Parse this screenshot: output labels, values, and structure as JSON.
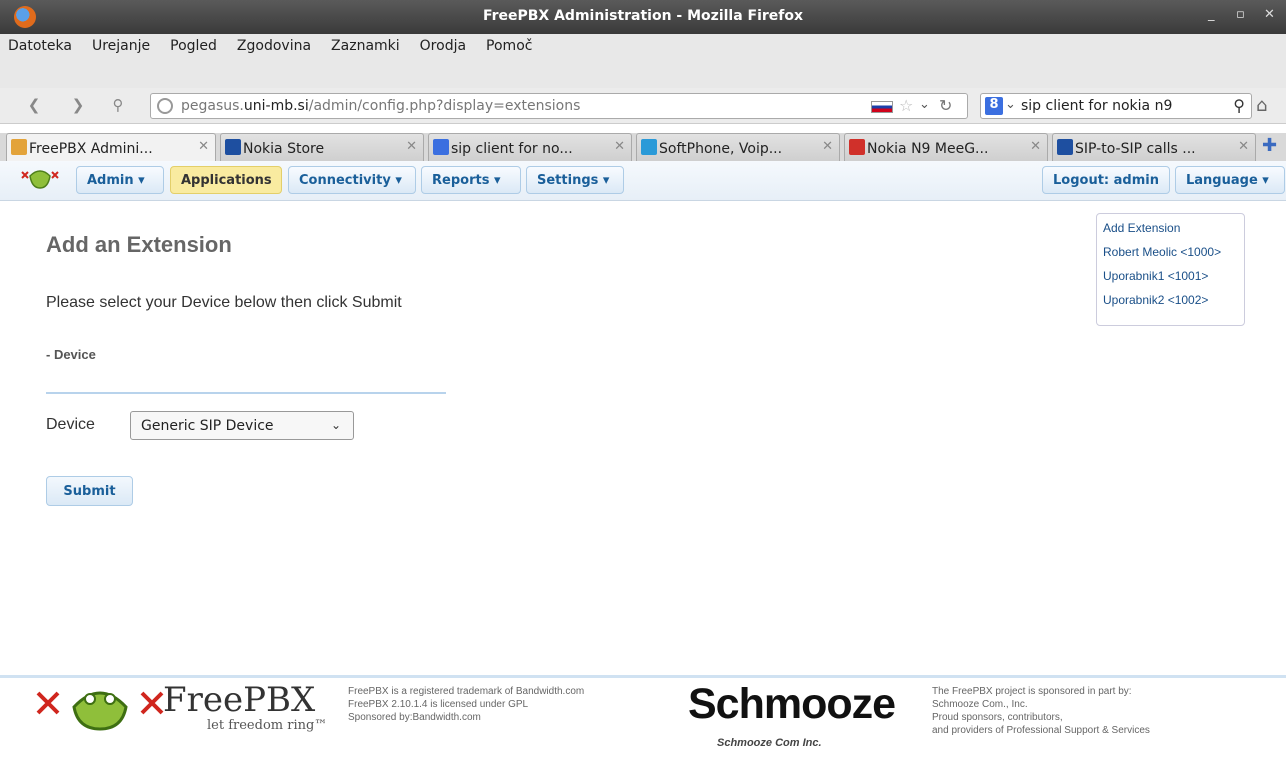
{
  "window": {
    "title": "FreePBX Administration - Mozilla Firefox",
    "controls": [
      "_",
      "▫",
      "✕"
    ]
  },
  "menubar": {
    "items": [
      {
        "label": "Datoteka"
      },
      {
        "label": "Urejanje"
      },
      {
        "label": "Pogled"
      },
      {
        "label": "Zgodovina"
      },
      {
        "label": "Zaznamki"
      },
      {
        "label": "Orodja"
      },
      {
        "label": "Pomoč"
      }
    ]
  },
  "navbar": {
    "url_prefix": "pegasus.",
    "url_domain": "uni-mb.si",
    "url_path": "/admin/config.php?display=extensions",
    "search_query": "sip client for nokia n9"
  },
  "tabs": [
    {
      "label": "FreePBX Admini...",
      "active": true,
      "icon_color": "#e3a33a"
    },
    {
      "label": "Nokia Store",
      "active": false,
      "icon_color": "#1e4fa0"
    },
    {
      "label": "sip client for no...",
      "active": false,
      "icon_color": "#3b6fe0"
    },
    {
      "label": "SoftPhone, Voip...",
      "active": false,
      "icon_color": "#2a9ad8"
    },
    {
      "label": "Nokia N9 MeeG...",
      "active": false,
      "icon_color": "#d0302a"
    },
    {
      "label": "SIP-to-SIP calls ...",
      "active": false,
      "icon_color": "#1e4fa0"
    }
  ],
  "pbxnav": {
    "admin": "Admin ▾",
    "applications": "Applications",
    "connectivity": "Connectivity ▾",
    "reports": "Reports ▾",
    "settings": "Settings ▾",
    "logout": "Logout: admin",
    "language": "Language ▾"
  },
  "content": {
    "heading": "Add an Extension",
    "intro": "Please select your Device below then click Submit",
    "section": "- Device",
    "device_label": "Device",
    "device_value": "Generic SIP Device",
    "submit_label": "Submit"
  },
  "right_nav": {
    "items": [
      "Add Extension",
      "Robert Meolic <1000>",
      "Uporabnik1 <1001>",
      "Uporabnik2 <1002>"
    ]
  },
  "footer": {
    "brand": "FreePBX",
    "slogan": "let freedom ring™",
    "trademark_lines": [
      "FreePBX is a registered trademark of Bandwidth.com",
      "FreePBX 2.10.1.4 is licensed under GPL",
      "Sponsored by:Bandwidth.com"
    ],
    "sponsor_logo": "Schmooze",
    "sponsor_sub": "Schmooze Com Inc.",
    "sponsor_lines": [
      "The FreePBX project is sponsored in part by:",
      "Schmooze Com., Inc.",
      "Proud sponsors, contributors,",
      "and providers of Professional Support & Services"
    ]
  }
}
